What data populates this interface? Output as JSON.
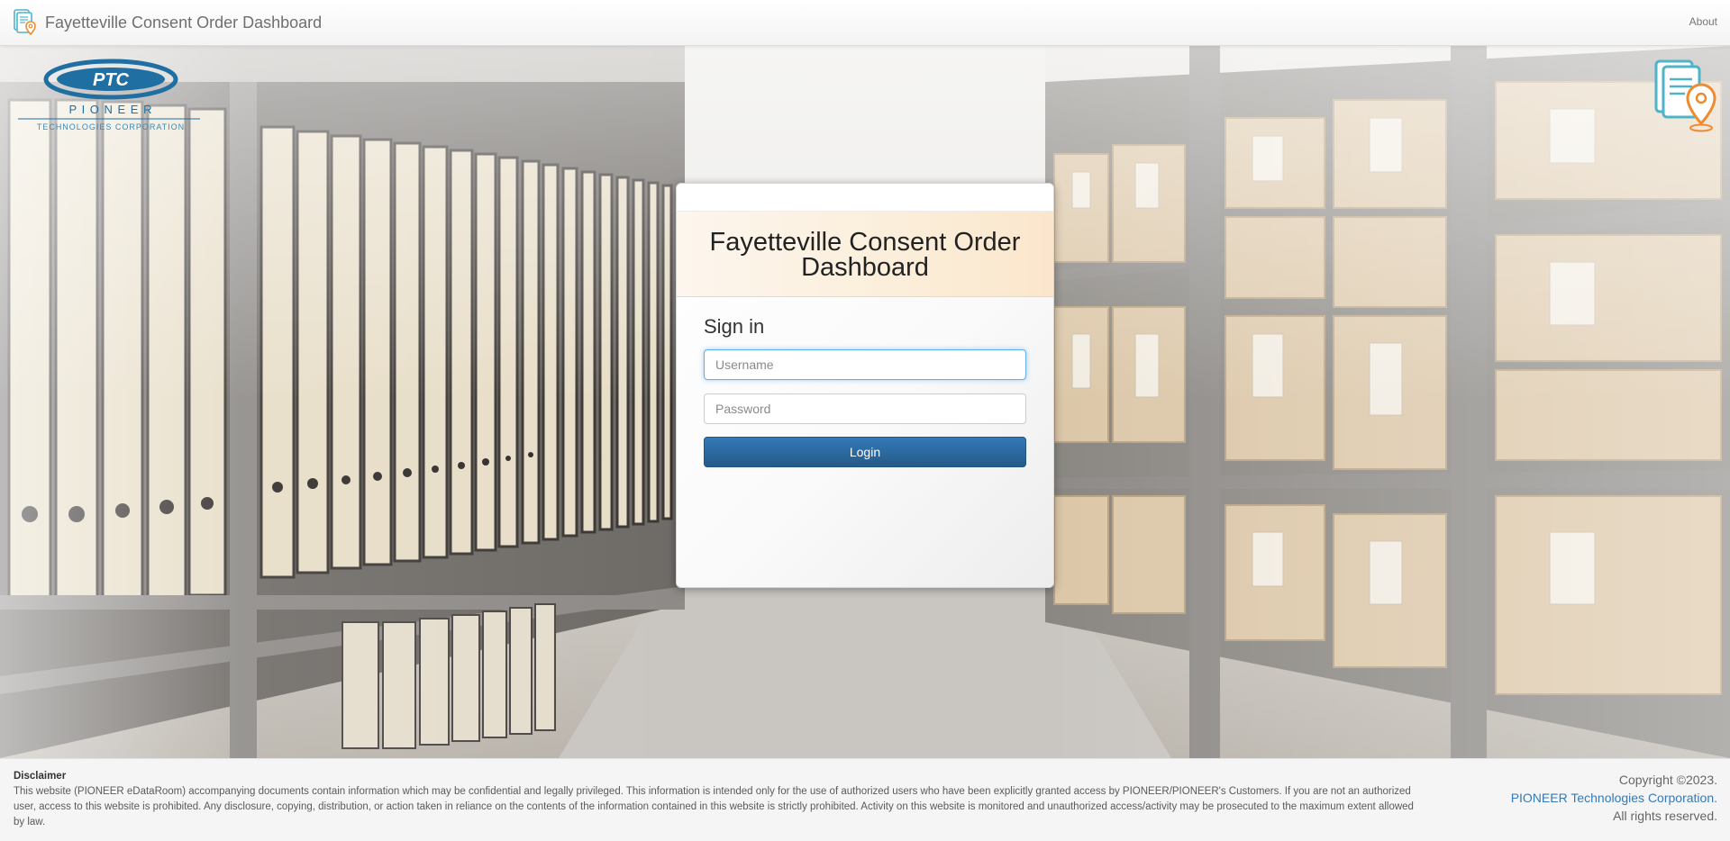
{
  "navbar": {
    "title": "Fayetteville Consent Order Dashboard",
    "about_label": "About"
  },
  "logo": {
    "letters": "PTC",
    "name": "P I O N E E R",
    "tagline": "TECHNOLOGIES CORPORATION",
    "color": "#1f6fa3"
  },
  "login": {
    "title": "Fayetteville Consent Order Dashboard",
    "heading": "Sign in",
    "username_placeholder": "Username",
    "password_placeholder": "Password",
    "login_label": "Login",
    "accent": "#337ab7"
  },
  "footer": {
    "disclaimer_title": "Disclaimer",
    "disclaimer_text": "This website (PIONEER eDataRoom) accompanying documents contain information which may be confidential and legally privileged. This information is intended only for the use of authorized users who have been explicitly granted access by PIONEER/PIONEER's Customers. If you are not an authorized user, access to this website is prohibited. Any disclosure, copying, distribution, or action taken in reliance on the contents of the information contained in this website is strictly prohibited. Activity on this website is monitored and unauthorized access/activity may be prosecuted to the maximum extent allowed by law.",
    "copyright": "Copyright ©2023.",
    "company_link": "PIONEER Technologies Corporation.",
    "rights": "All rights reserved."
  },
  "icons": {
    "nav": "document-location-icon",
    "corner": "document-location-icon"
  }
}
